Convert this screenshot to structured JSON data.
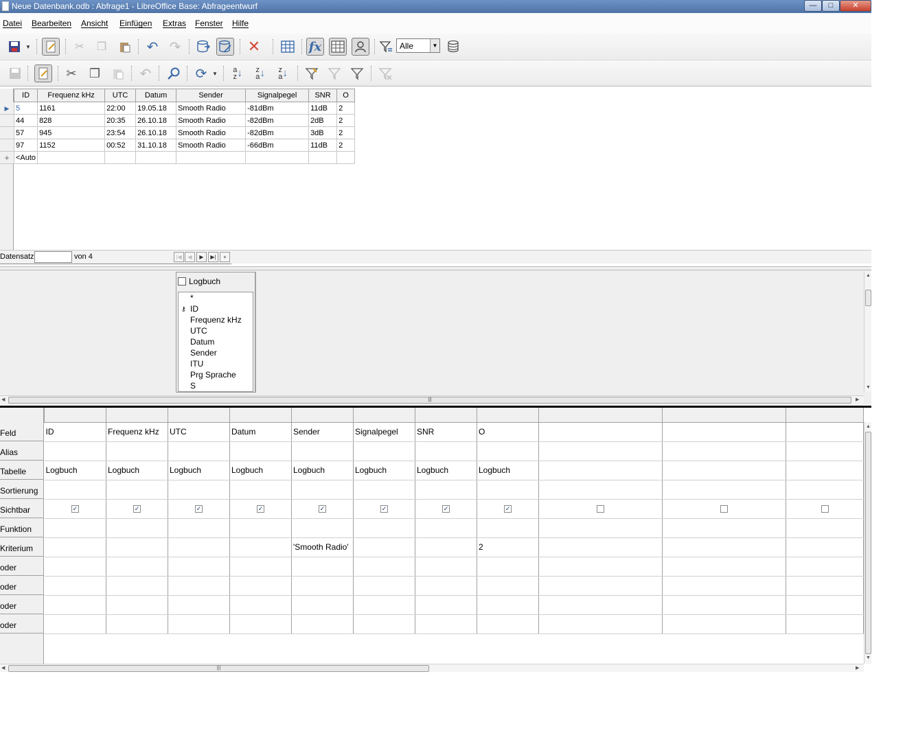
{
  "window": {
    "title": "Neue Datenbank.odb : Abfrage1 - LibreOffice Base: Abfrageentwurf",
    "min_label": "—",
    "max_label": "□",
    "close_label": "✕"
  },
  "menu": {
    "items": [
      "Datei",
      "Bearbeiten",
      "Ansicht",
      "Einfügen",
      "Extras",
      "Fenster",
      "Hilfe"
    ]
  },
  "toolbar1": {
    "icons": [
      "save-icon",
      "save-dropdown-icon",
      "edit-mode-icon",
      "cut-icon",
      "copy-icon",
      "paste-icon",
      "undo-icon",
      "redo-icon",
      "run-query-icon",
      "toggle-design-view-icon",
      "clear-query-icon",
      "add-tables-icon",
      "functions-icon",
      "table-name-icon",
      "alias-icon",
      "distinct-values-icon",
      "limit-icon"
    ],
    "limit_value": "Alle"
  },
  "toolbar2": {
    "icons": [
      "save-record-icon",
      "edit-data-icon",
      "cut-icon",
      "copy-icon",
      "paste-icon",
      "undo-icon",
      "find-record-icon",
      "refresh-icon",
      "sort-ascending-icon",
      "sort-descending-icon",
      "sort-icon",
      "autofilter-icon",
      "apply-filter-icon",
      "standard-filter-icon",
      "reset-filter-icon"
    ]
  },
  "datagrid": {
    "columns": [
      "ID",
      "Frequenz kHz",
      "UTC",
      "Datum",
      "Sender",
      "Signalpegel",
      "SNR",
      "O"
    ],
    "rows": [
      [
        "5",
        "1161",
        "22:00",
        "19.05.18",
        "Smooth Radio",
        "-81dBm",
        "11dB",
        "2"
      ],
      [
        "44",
        "828",
        "20:35",
        "26.10.18",
        "Smooth Radio",
        "-82dBm",
        "2dB",
        "2"
      ],
      [
        "57",
        "945",
        "23:54",
        "26.10.18",
        "Smooth Radio",
        "-82dBm",
        "3dB",
        "2"
      ],
      [
        "97",
        "1152",
        "00:52",
        "31.10.18",
        "Smooth Radio",
        "-66dBm",
        "11dB",
        "2"
      ]
    ],
    "new_row": [
      "<Auto",
      "",
      "",
      "",
      "",
      "",
      "",
      ""
    ]
  },
  "navigator": {
    "label": "Datensatz",
    "record_value": "",
    "of_label": "von 4"
  },
  "table_window": {
    "title": "Logbuch",
    "fields": [
      "*",
      "ID",
      "Frequenz kHz",
      "UTC",
      "Datum",
      "Sender",
      "ITU",
      "Prg Sprache",
      "S"
    ]
  },
  "design": {
    "row_labels": [
      "Feld",
      "Alias",
      "Tabelle",
      "Sortierung",
      "Sichtbar",
      "Funktion",
      "Kriterium",
      "oder",
      "oder",
      "oder",
      "oder"
    ],
    "columns": [
      {
        "feld": "ID",
        "tabelle": "Logbuch",
        "sichtbar": true,
        "kriterium": ""
      },
      {
        "feld": "Frequenz kHz",
        "tabelle": "Logbuch",
        "sichtbar": true,
        "kriterium": ""
      },
      {
        "feld": "UTC",
        "tabelle": "Logbuch",
        "sichtbar": true,
        "kriterium": ""
      },
      {
        "feld": "Datum",
        "tabelle": "Logbuch",
        "sichtbar": true,
        "kriterium": ""
      },
      {
        "feld": "Sender",
        "tabelle": "Logbuch",
        "sichtbar": true,
        "kriterium": "'Smooth Radio'"
      },
      {
        "feld": "Signalpegel",
        "tabelle": "Logbuch",
        "sichtbar": true,
        "kriterium": ""
      },
      {
        "feld": "SNR",
        "tabelle": "Logbuch",
        "sichtbar": true,
        "kriterium": ""
      },
      {
        "feld": "O",
        "tabelle": "Logbuch",
        "sichtbar": true,
        "kriterium": "2"
      },
      {
        "feld": "",
        "tabelle": "",
        "sichtbar": false,
        "kriterium": ""
      },
      {
        "feld": "",
        "tabelle": "",
        "sichtbar": false,
        "kriterium": ""
      },
      {
        "feld": "",
        "tabelle": "",
        "sichtbar": false,
        "kriterium": ""
      }
    ]
  },
  "colors": {
    "titlebar": "#5a7fb4",
    "icon_blue": "#3a6aa8",
    "grid_border": "#a0a0a0"
  }
}
